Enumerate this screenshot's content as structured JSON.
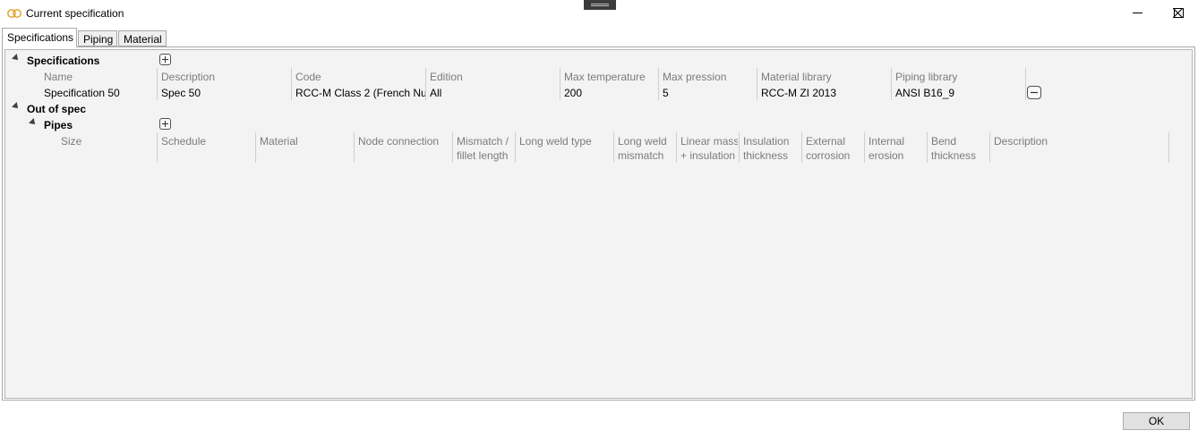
{
  "window": {
    "title": "Current specification",
    "icon": "link-rings-icon",
    "accent": "#e0a020"
  },
  "tabs": [
    "Specifications",
    "Piping",
    "Material"
  ],
  "tree": {
    "specifications_label": "Specifications",
    "out_of_spec_label": "Out of spec",
    "pipes_label": "Pipes"
  },
  "spec_table": {
    "columns": [
      "Name",
      "Description",
      "Code",
      "Edition",
      "Max temperature",
      "Max pression",
      "Material library",
      "Piping library"
    ],
    "rows": [
      [
        "Specification 50",
        "Spec 50",
        "RCC-M Class 2 (French Nuc",
        "All",
        "200",
        "5",
        "RCC-M ZI 2013",
        "ANSI B16_9"
      ]
    ]
  },
  "pipes_table": {
    "columns": [
      [
        "Size"
      ],
      [
        "Schedule"
      ],
      [
        "Material"
      ],
      [
        "Node connection"
      ],
      [
        "Mismatch /",
        "fillet length"
      ],
      [
        "Long weld type"
      ],
      [
        "Long weld",
        "mismatch"
      ],
      [
        "Linear mass",
        "+ insulation"
      ],
      [
        "Insulation",
        "thickness"
      ],
      [
        "External",
        "corrosion"
      ],
      [
        "Internal",
        "erosion"
      ],
      [
        "Bend",
        "thickness"
      ],
      [
        "Description"
      ]
    ]
  },
  "buttons": {
    "ok": "OK"
  }
}
